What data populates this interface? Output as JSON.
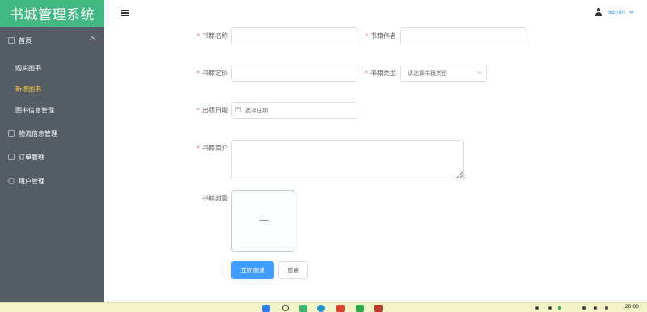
{
  "app": {
    "title": "书城管理系统"
  },
  "sidebar": {
    "items": [
      {
        "label": "首页",
        "icon": "monitor-icon",
        "expanded": true
      },
      {
        "label": "物流信息管理",
        "icon": "truck-icon"
      },
      {
        "label": "订单管理",
        "icon": "order-icon"
      },
      {
        "label": "用户管理",
        "icon": "user-settings-icon"
      }
    ],
    "subitems": [
      {
        "label": "购买图书",
        "active": false
      },
      {
        "label": "新增图书",
        "active": true
      },
      {
        "label": "图书信息管理",
        "active": false
      }
    ],
    "bg_color": "#545c64",
    "active_color": "#ffd04b",
    "logo_color": "#42b983"
  },
  "header": {
    "menu_icon": "hamburger-icon",
    "user": {
      "name": "admin",
      "icon": "user-icon"
    }
  },
  "form": {
    "required_mark": "*",
    "fields": {
      "name": {
        "label": "书籍名称",
        "value": ""
      },
      "author": {
        "label": "书籍作者",
        "value": ""
      },
      "price": {
        "label": "书籍定价",
        "value": ""
      },
      "type": {
        "label": "书籍类型",
        "placeholder": "请选择书籍类型"
      },
      "date": {
        "label": "出版日期",
        "placeholder": "选择日期"
      },
      "intro": {
        "label": "书籍简介",
        "value": ""
      },
      "cover": {
        "label": "书籍封面"
      }
    },
    "submit_label": "立即创建",
    "reset_label": "重置",
    "primary_color": "#409eff"
  },
  "taskbar": {
    "clock": "20:00"
  }
}
